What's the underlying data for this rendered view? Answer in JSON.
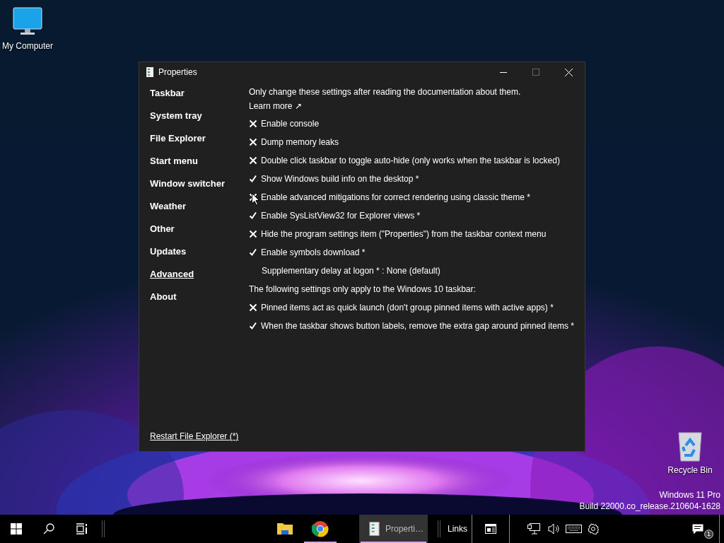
{
  "desktop_icons": [
    {
      "kind": "computer",
      "label": "My Computer"
    },
    {
      "kind": "recycle-bin",
      "label": "Recycle Bin"
    }
  ],
  "build_info": [
    "Windows 11 Pro",
    "Build 22000.co_release.210604-1628"
  ],
  "window": {
    "title": "Properties",
    "sidebar": [
      {
        "label": "Taskbar",
        "selected": false
      },
      {
        "label": "System tray",
        "selected": false
      },
      {
        "label": "File Explorer",
        "selected": false
      },
      {
        "label": "Start menu",
        "selected": false
      },
      {
        "label": "Window switcher",
        "selected": false
      },
      {
        "label": "Weather",
        "selected": false
      },
      {
        "label": "Other",
        "selected": false
      },
      {
        "label": "Updates",
        "selected": false
      },
      {
        "label": "Advanced",
        "selected": true
      },
      {
        "label": "About",
        "selected": false
      }
    ],
    "intro": "Only change these settings after reading the documentation about them.",
    "learn_more": "Learn more ↗",
    "settings": [
      {
        "kind": "toggle",
        "label": "Enable console",
        "checked": false
      },
      {
        "kind": "toggle",
        "label": "Dump memory leaks",
        "checked": false
      },
      {
        "kind": "toggle",
        "label": "Double click taskbar to toggle auto-hide (only works when the taskbar is locked)",
        "checked": false
      },
      {
        "kind": "toggle",
        "label": "Show Windows build info on the desktop *",
        "checked": true
      },
      {
        "kind": "toggle",
        "label": "Enable advanced mitigations for correct rendering using classic theme *",
        "checked": false
      },
      {
        "kind": "toggle",
        "label": "Enable SysListView32 for Explorer views *",
        "checked": true
      },
      {
        "kind": "toggle",
        "label": "Hide the program settings item (\"Properties\") from the taskbar context menu",
        "checked": false
      },
      {
        "kind": "toggle",
        "label": "Enable symbols download *",
        "checked": true
      },
      {
        "kind": "choice",
        "label": "Supplementary delay at logon * : None (default)"
      },
      {
        "kind": "heading",
        "label": "The following settings only apply to the Windows 10 taskbar:"
      },
      {
        "kind": "toggle",
        "label": "Pinned items act as quick launch (don't group pinned items with active apps) *",
        "checked": false
      },
      {
        "kind": "toggle",
        "label": "When the taskbar shows button labels, remove the extra gap around pinned items *",
        "checked": true
      }
    ],
    "footer_link": "Restart File Explorer (*)"
  },
  "taskbar": {
    "apps": [
      {
        "kind": "folder",
        "running": false,
        "selected": false
      },
      {
        "kind": "browser",
        "running": true,
        "selected": false
      },
      {
        "kind": "properties",
        "label": "Properti…",
        "running": true,
        "selected": true
      }
    ],
    "toolbar_label": "Links",
    "notification_count": "1"
  }
}
